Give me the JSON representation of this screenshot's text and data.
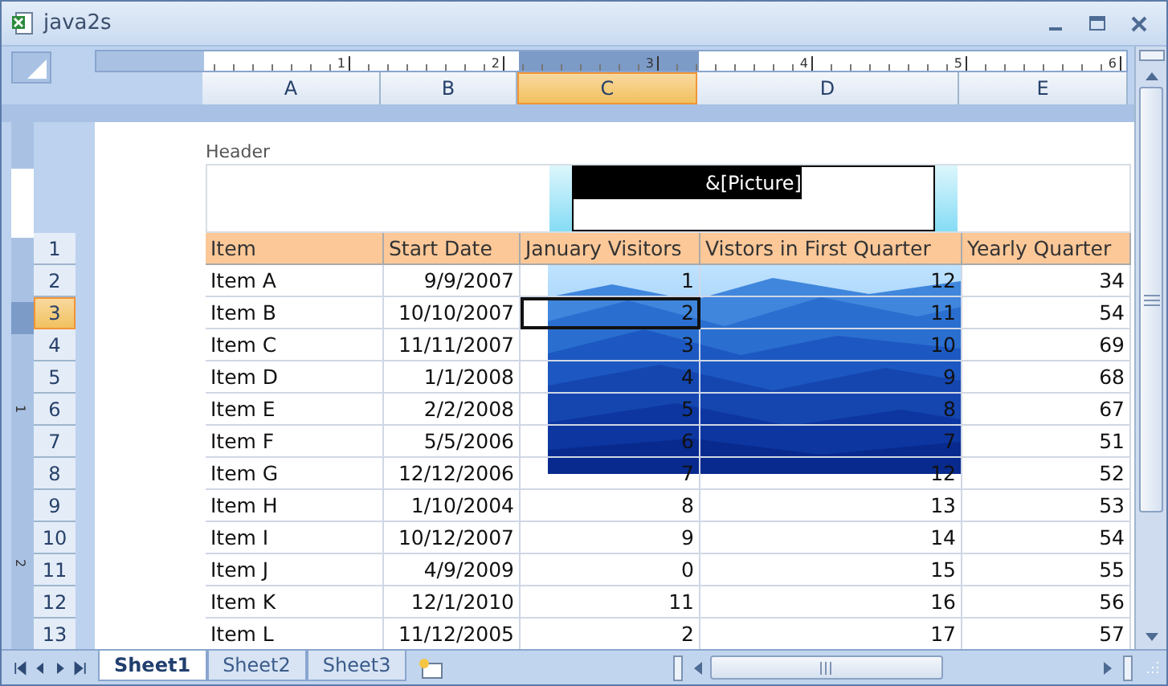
{
  "window": {
    "title": "java2s"
  },
  "ruler": {
    "labels": [
      "1",
      "2",
      "3",
      "4",
      "5",
      "6"
    ]
  },
  "vertical_ruler": {
    "labels": [
      "1",
      "2"
    ]
  },
  "columns": [
    {
      "label": "A",
      "selected": false
    },
    {
      "label": "B",
      "selected": false
    },
    {
      "label": "C",
      "selected": true
    },
    {
      "label": "D",
      "selected": false
    },
    {
      "label": "E",
      "selected": false
    }
  ],
  "row_numbers": [
    {
      "label": "1",
      "selected": false
    },
    {
      "label": "2",
      "selected": false
    },
    {
      "label": "3",
      "selected": true
    },
    {
      "label": "4",
      "selected": false
    },
    {
      "label": "5",
      "selected": false
    },
    {
      "label": "6",
      "selected": false
    },
    {
      "label": "7",
      "selected": false
    },
    {
      "label": "8",
      "selected": false
    },
    {
      "label": "9",
      "selected": false
    },
    {
      "label": "10",
      "selected": false
    },
    {
      "label": "11",
      "selected": false
    },
    {
      "label": "12",
      "selected": false
    },
    {
      "label": "13",
      "selected": false
    }
  ],
  "page": {
    "header_label": "Header",
    "header_field": {
      "value": "&[Picture]",
      "text_selected": true
    }
  },
  "table": {
    "columns": [
      "Item",
      "Start Date",
      "January Visitors",
      "Vistors in First Quarter",
      "Yearly Quarter"
    ],
    "rows": [
      [
        "Item A",
        "9/9/2007",
        "1",
        "12",
        "34"
      ],
      [
        "Item B",
        "10/10/2007",
        "2",
        "11",
        "54"
      ],
      [
        "Item C",
        "11/11/2007",
        "3",
        "10",
        "69"
      ],
      [
        "Item D",
        "1/1/2008",
        "4",
        "9",
        "68"
      ],
      [
        "Item E",
        "2/2/2008",
        "5",
        "8",
        "67"
      ],
      [
        "Item F",
        "5/5/2006",
        "6",
        "7",
        "51"
      ],
      [
        "Item G",
        "12/12/2006",
        "7",
        "12",
        "52"
      ],
      [
        "Item H",
        "1/10/2004",
        "8",
        "13",
        "53"
      ],
      [
        "Item I",
        "10/12/2007",
        "9",
        "14",
        "54"
      ],
      [
        "Item J",
        "4/9/2009",
        "0",
        "15",
        "55"
      ],
      [
        "Item K",
        "12/1/2010",
        "11",
        "16",
        "56"
      ],
      [
        "Item L",
        "11/12/2005",
        "2",
        "17",
        "57"
      ]
    ]
  },
  "sheet_tabs": [
    {
      "label": "Sheet1",
      "selected": true
    },
    {
      "label": "Sheet2",
      "selected": false
    },
    {
      "label": "Sheet3",
      "selected": false
    }
  ]
}
